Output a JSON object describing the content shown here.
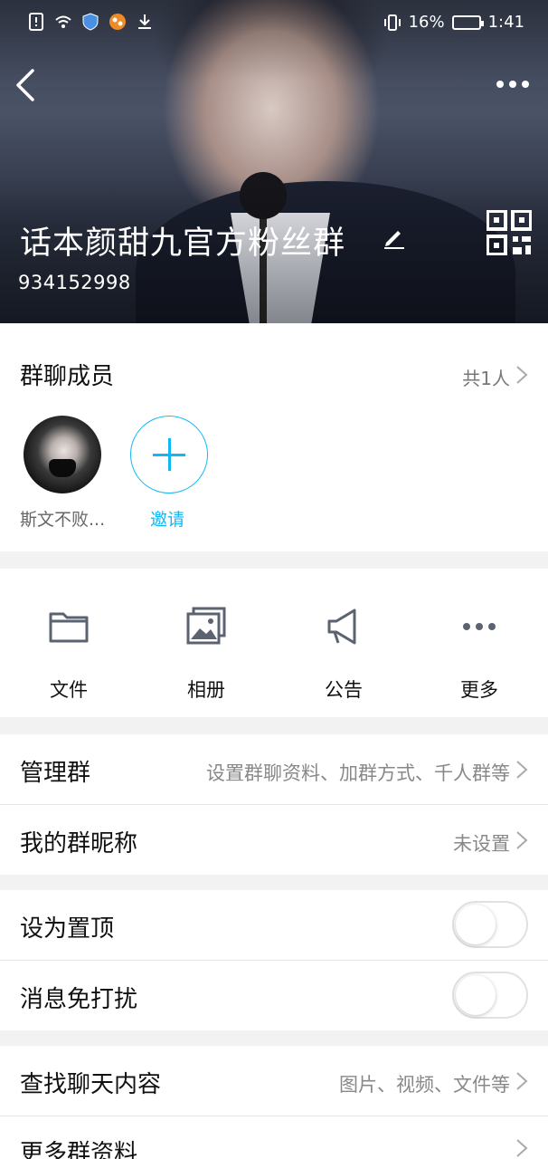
{
  "statusbar": {
    "battery": "16%",
    "time": "1:41"
  },
  "header": {
    "group_name": "话本颜甜九官方粉丝群",
    "group_id": "934152998"
  },
  "members": {
    "title": "群聊成员",
    "count": "共1人",
    "items": [
      {
        "name": "斯文不败..."
      }
    ],
    "invite_label": "邀请"
  },
  "actions": [
    {
      "label": "文件",
      "icon": "folder-icon"
    },
    {
      "label": "相册",
      "icon": "album-icon"
    },
    {
      "label": "公告",
      "icon": "megaphone-icon"
    },
    {
      "label": "更多",
      "icon": "more-dots-icon"
    }
  ],
  "settings": {
    "manage": {
      "title": "管理群",
      "value": "设置群聊资料、加群方式、千人群等"
    },
    "nickname": {
      "title": "我的群昵称",
      "value": "未设置"
    },
    "pin": {
      "title": "设为置顶",
      "on": false
    },
    "mute": {
      "title": "消息免打扰",
      "on": false
    },
    "search": {
      "title": "查找聊天内容",
      "value": "图片、视频、文件等"
    },
    "more_info": {
      "title": "更多群资料"
    }
  },
  "colors": {
    "accent": "#12b7f5",
    "icon_gray": "#5b6270"
  }
}
